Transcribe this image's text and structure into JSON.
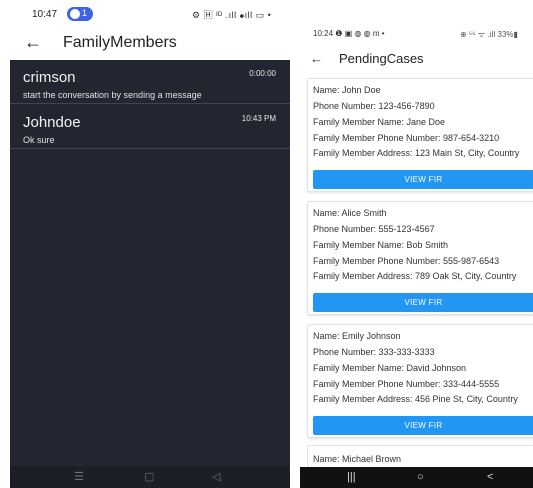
{
  "left_phone": {
    "status_bar": {
      "time": "10:47",
      "badge_count": "1",
      "right_text": "⚙ 🄷 ᴵᴰ .ıll ⦁ıll ▭ •"
    },
    "app_bar": {
      "back_icon": "←",
      "title": "FamilyMembers"
    },
    "chats": [
      {
        "name": "crimson",
        "time": "0:00:00",
        "message": "start the conversation by sending a message"
      },
      {
        "name": "Johndoe",
        "time": "10:43 PM",
        "message": "Ok sure"
      }
    ],
    "nav_bar": {
      "menu_icon": "☰",
      "home_icon": "▢",
      "back_icon": "◁"
    },
    "colors": {
      "chat_background": "#212631",
      "divider": "#3c4455",
      "text": "#f2f2f2"
    }
  },
  "right_phone": {
    "status_bar": {
      "time": "10:24 ❶ ▣ ◍ ◍ m •",
      "right_text": "⊕ ⁵⁶ ᯤ .ıll 33%▮"
    },
    "app_bar": {
      "back_icon": "←",
      "title": "PendingCases"
    },
    "cases": [
      {
        "name": "Name: John Doe",
        "phone": "Phone Number: 123-456-7890",
        "member_name": "Family Member Name: Jane Doe",
        "member_phone": "Family Member Phone Number: 987-654-3210",
        "member_address": "Family Member Address: 123 Main St, City, Country",
        "button_label": "VIEW FIR"
      },
      {
        "name": "Name: Alice Smith",
        "phone": "Phone Number: 555-123-4567",
        "member_name": "Family Member Name: Bob Smith",
        "member_phone": "Family Member Phone Number: 555-987-6543",
        "member_address": "Family Member Address: 789 Oak St, City, Country",
        "button_label": "VIEW FIR"
      },
      {
        "name": "Name: Emily Johnson",
        "phone": "Phone Number: 333-333-3333",
        "member_name": "Family Member Name: David Johnson",
        "member_phone": "Family Member Phone Number: 333-444-5555",
        "member_address": "Family Member Address: 456 Pine St, City, Country",
        "button_label": "VIEW FIR"
      }
    ],
    "partial_case": {
      "name": "Name: Michael Brown"
    },
    "nav_bar": {
      "recents_icon": "|||",
      "home_icon": "○",
      "back_icon": "<"
    },
    "colors": {
      "button": "#2196f3",
      "button_text": "#ffffff"
    }
  }
}
